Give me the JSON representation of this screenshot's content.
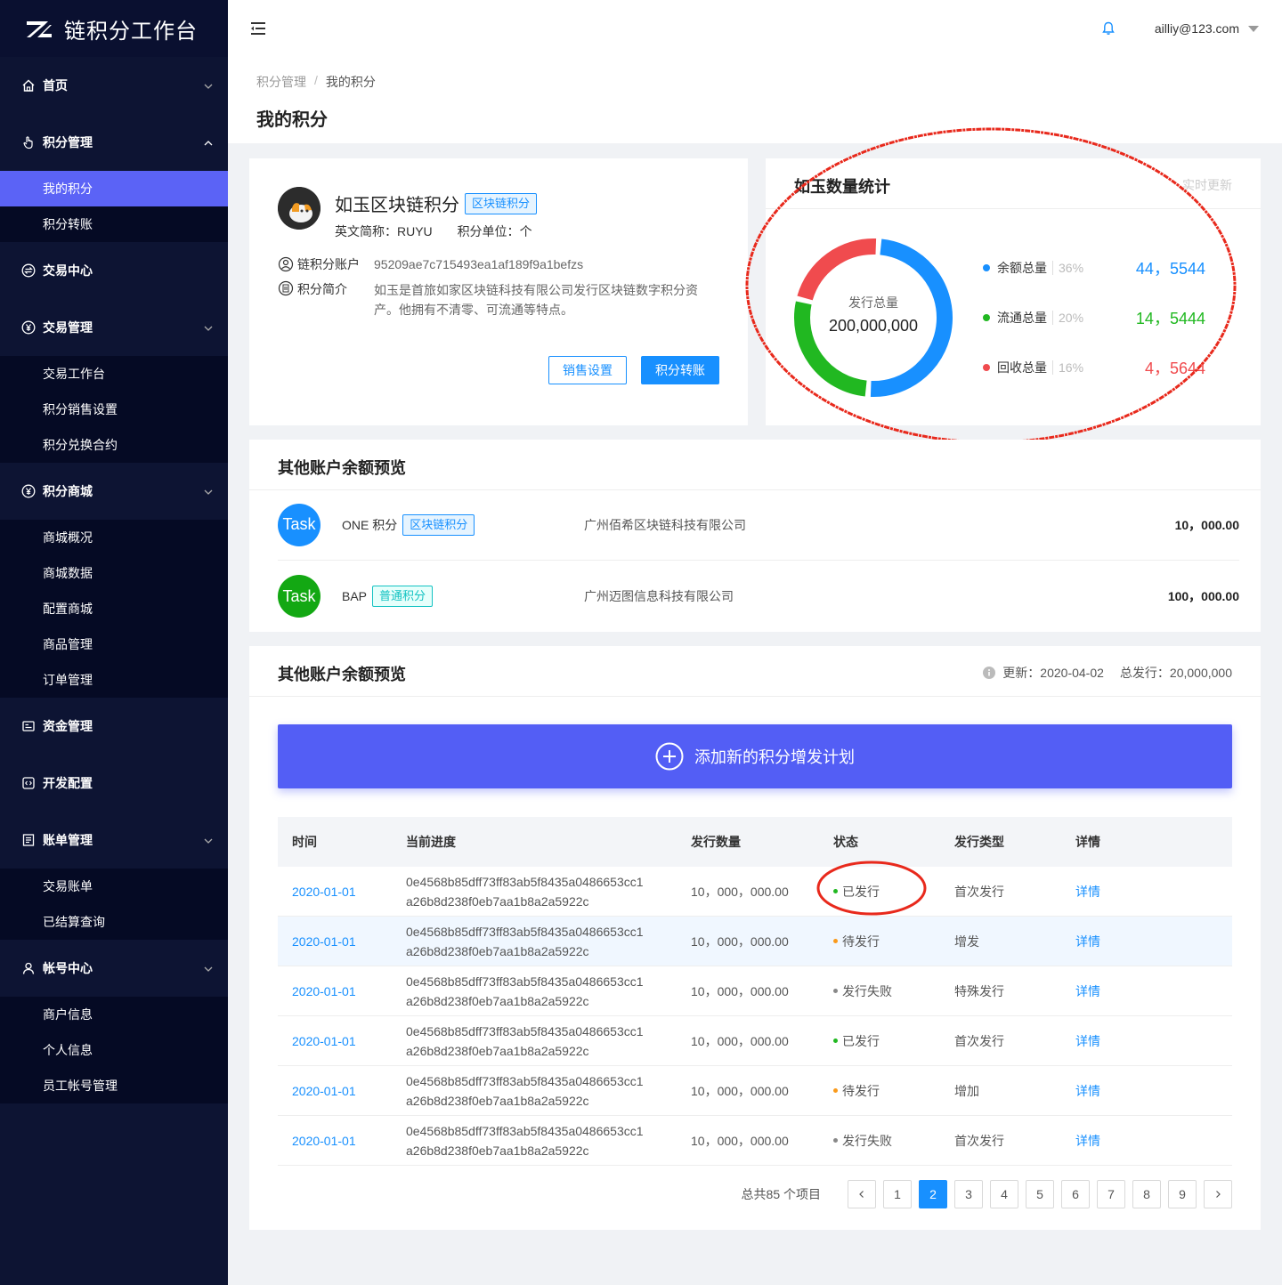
{
  "app": {
    "title": "链积分工作台"
  },
  "sidebar": {
    "groups": [
      {
        "label": "首页",
        "icon": "home-icon",
        "items": []
      },
      {
        "label": "积分管理",
        "icon": "hand-pointer-icon",
        "items": [
          "我的积分",
          "积分转账"
        ],
        "active_item": "我的积分"
      },
      {
        "label": "交易中心",
        "icon": "exchange-icon",
        "items": []
      },
      {
        "label": "交易管理",
        "icon": "yen-circle-icon",
        "items": [
          "交易工作台",
          "积分销售设置",
          "积分兑换合约"
        ]
      },
      {
        "label": "积分商城",
        "icon": "yen-circle-icon",
        "items": [
          "商城概况",
          "商城数据",
          "配置商城",
          "商品管理",
          "订单管理"
        ]
      },
      {
        "label": "资金管理",
        "icon": "wallet-icon",
        "items": []
      },
      {
        "label": "开发配置",
        "icon": "code-icon",
        "items": []
      },
      {
        "label": "账单管理",
        "icon": "bill-icon",
        "items": [
          "交易账单",
          "已结算查询"
        ]
      },
      {
        "label": "帐号中心",
        "icon": "user-icon",
        "items": [
          "商户信息",
          "个人信息",
          "员工帐号管理"
        ]
      }
    ]
  },
  "header": {
    "user_email": "ailliy@123.com"
  },
  "breadcrumb": {
    "parent": "积分管理",
    "separator": "/",
    "current": "我的积分"
  },
  "page_title": "我的积分",
  "token": {
    "name": "如玉区块链积分",
    "tag": "区块链积分",
    "abbr_label": "英文简称：",
    "abbr": "RUYU",
    "unit_label": "积分单位：",
    "unit": "个",
    "account_label": "链积分账户",
    "account": "95209ae7c715493ea1af189f9a1befzs",
    "intro_label": "积分简介",
    "intro": "如玉是首旅如家区块链科技有限公司发行区块链数字积分资产。他拥有不清零、可流通等特点。",
    "btn_sale": "销售设置",
    "btn_transfer": "积分转账"
  },
  "stats": {
    "title": "如玉数量统计",
    "update_label": "实时更新",
    "center_label": "发行总量",
    "center_value": "200,000,000",
    "legend": [
      {
        "name": "余额总量",
        "pct": "36%",
        "value": "44，5544",
        "color": "#1890ff"
      },
      {
        "name": "流通总量",
        "pct": "20%",
        "value": "14，5444",
        "color": "#21b821"
      },
      {
        "name": "回收总量",
        "pct": "16%",
        "value": "4，5644",
        "color": "#f04b4e"
      }
    ]
  },
  "chart_data": {
    "type": "pie",
    "categories": [
      "余额总量",
      "流通总量",
      "回收总量"
    ],
    "values": [
      36,
      20,
      16
    ],
    "title": "如玉数量统计"
  },
  "accounts": {
    "title": "其他账户余额预览",
    "rows": [
      {
        "avatar": "Task",
        "avatar_color": "#1890ff",
        "name": "ONE 积分",
        "tag": "区块链积分",
        "tag_style": "blue",
        "company": "广州佰希区块链科技有限公司",
        "amount": "10，000.00"
      },
      {
        "avatar": "Task",
        "avatar_color": "#13a813",
        "name": "BAP",
        "tag": "普通积分",
        "tag_style": "cyan",
        "company": "广州迈图信息科技有限公司",
        "amount": "100，000.00"
      }
    ]
  },
  "issuance": {
    "title": "其他账户余额预览",
    "update_label": "更新：",
    "update_date": "2020-04-02",
    "total_label": "总发行：",
    "total": "20,000,000",
    "add_button": "添加新的积分增发计划",
    "columns": [
      "时间",
      "当前进度",
      "发行数量",
      "状态",
      "发行类型",
      "详情"
    ],
    "rows": [
      {
        "date": "2020-01-01",
        "hash1": "0e4568b85dff73ff83ab5f8435a0486653cc1",
        "hash2": "a26b8d238f0eb7aa1b8a2a5922c",
        "amount": "10，000，000.00",
        "status": "已发行",
        "status_color": "#21b821",
        "type": "首次发行",
        "detail": "详情"
      },
      {
        "date": "2020-01-01",
        "hash1": "0e4568b85dff73ff83ab5f8435a0486653cc1",
        "hash2": "a26b8d238f0eb7aa1b8a2a5922c",
        "amount": "10，000，000.00",
        "status": "待发行",
        "status_color": "#fa9a1b",
        "type": "增发",
        "detail": "详情"
      },
      {
        "date": "2020-01-01",
        "hash1": "0e4568b85dff73ff83ab5f8435a0486653cc1",
        "hash2": "a26b8d238f0eb7aa1b8a2a5922c",
        "amount": "10，000，000.00",
        "status": "发行失败",
        "status_color": "#888888",
        "type": "特殊发行",
        "detail": "详情"
      },
      {
        "date": "2020-01-01",
        "hash1": "0e4568b85dff73ff83ab5f8435a0486653cc1",
        "hash2": "a26b8d238f0eb7aa1b8a2a5922c",
        "amount": "10，000，000.00",
        "status": "已发行",
        "status_color": "#21b821",
        "type": "首次发行",
        "detail": "详情"
      },
      {
        "date": "2020-01-01",
        "hash1": "0e4568b85dff73ff83ab5f8435a0486653cc1",
        "hash2": "a26b8d238f0eb7aa1b8a2a5922c",
        "amount": "10，000，000.00",
        "status": "待发行",
        "status_color": "#fa9a1b",
        "type": "增加",
        "detail": "详情"
      },
      {
        "date": "2020-01-01",
        "hash1": "0e4568b85dff73ff83ab5f8435a0486653cc1",
        "hash2": "a26b8d238f0eb7aa1b8a2a5922c",
        "amount": "10，000，000.00",
        "status": "发行失败",
        "status_color": "#888888",
        "type": "首次发行",
        "detail": "详情"
      }
    ],
    "pagination": {
      "total_text": "总共85 个项目",
      "pages": [
        "1",
        "2",
        "3",
        "4",
        "5",
        "6",
        "7",
        "8",
        "9"
      ],
      "current": "2"
    }
  }
}
